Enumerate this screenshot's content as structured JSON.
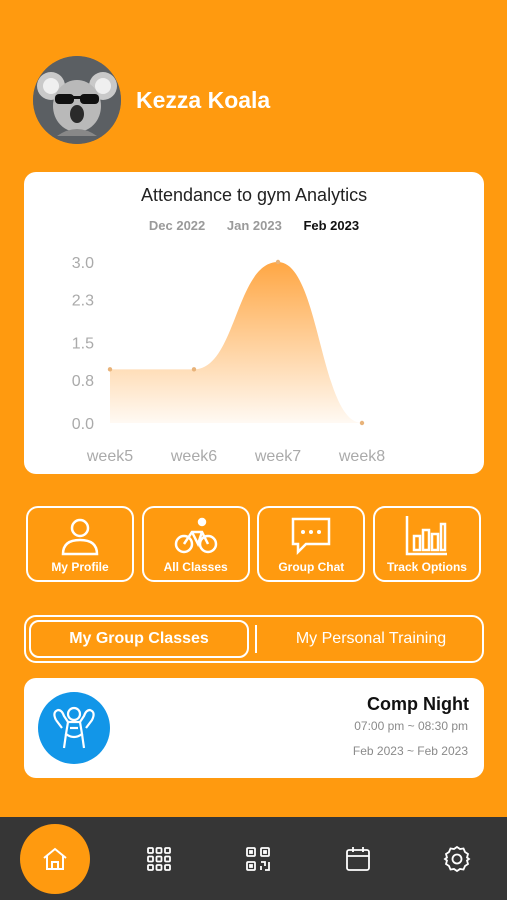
{
  "profile": {
    "name": "Kezza Koala",
    "avatar_icon": "koala-avatar"
  },
  "chart_data": {
    "type": "area",
    "title": "Attendance to gym Analytics",
    "periods": [
      "Dec 2022",
      "Jan 2023",
      "Feb 2023"
    ],
    "selected_period": "Feb 2023",
    "categories": [
      "week5",
      "week6",
      "week7",
      "week8"
    ],
    "values": [
      1.0,
      1.0,
      3.0,
      0.0
    ],
    "ytick_labels": [
      "3.0",
      "2.3",
      "1.5",
      "0.8",
      "0.0"
    ],
    "ylim": [
      0,
      3
    ],
    "grid": false,
    "color": "#FFA23A"
  },
  "actions": [
    {
      "label": "My Profile",
      "icon": "person-icon"
    },
    {
      "label": "All Classes",
      "icon": "bicycle-icon"
    },
    {
      "label": "Group Chat",
      "icon": "chat-bubble-icon"
    },
    {
      "label": "Track Options",
      "icon": "bar-chart-icon"
    }
  ],
  "segments": {
    "group": "My Group Classes",
    "personal": "My Personal Training",
    "active": "group"
  },
  "class_card": {
    "title": "Comp Night",
    "time": "07:00 pm ~ 08:30 pm",
    "dates": "Feb 2023 ~ Feb 2023",
    "icon": "bodybuilder-icon"
  },
  "nav": [
    "home-icon",
    "grid-icon",
    "qr-code-icon",
    "calendar-icon",
    "settings-icon"
  ],
  "colors": {
    "primary": "#FF9A0F",
    "nav_bg": "#363636",
    "class_icon_bg": "#1296E8"
  }
}
